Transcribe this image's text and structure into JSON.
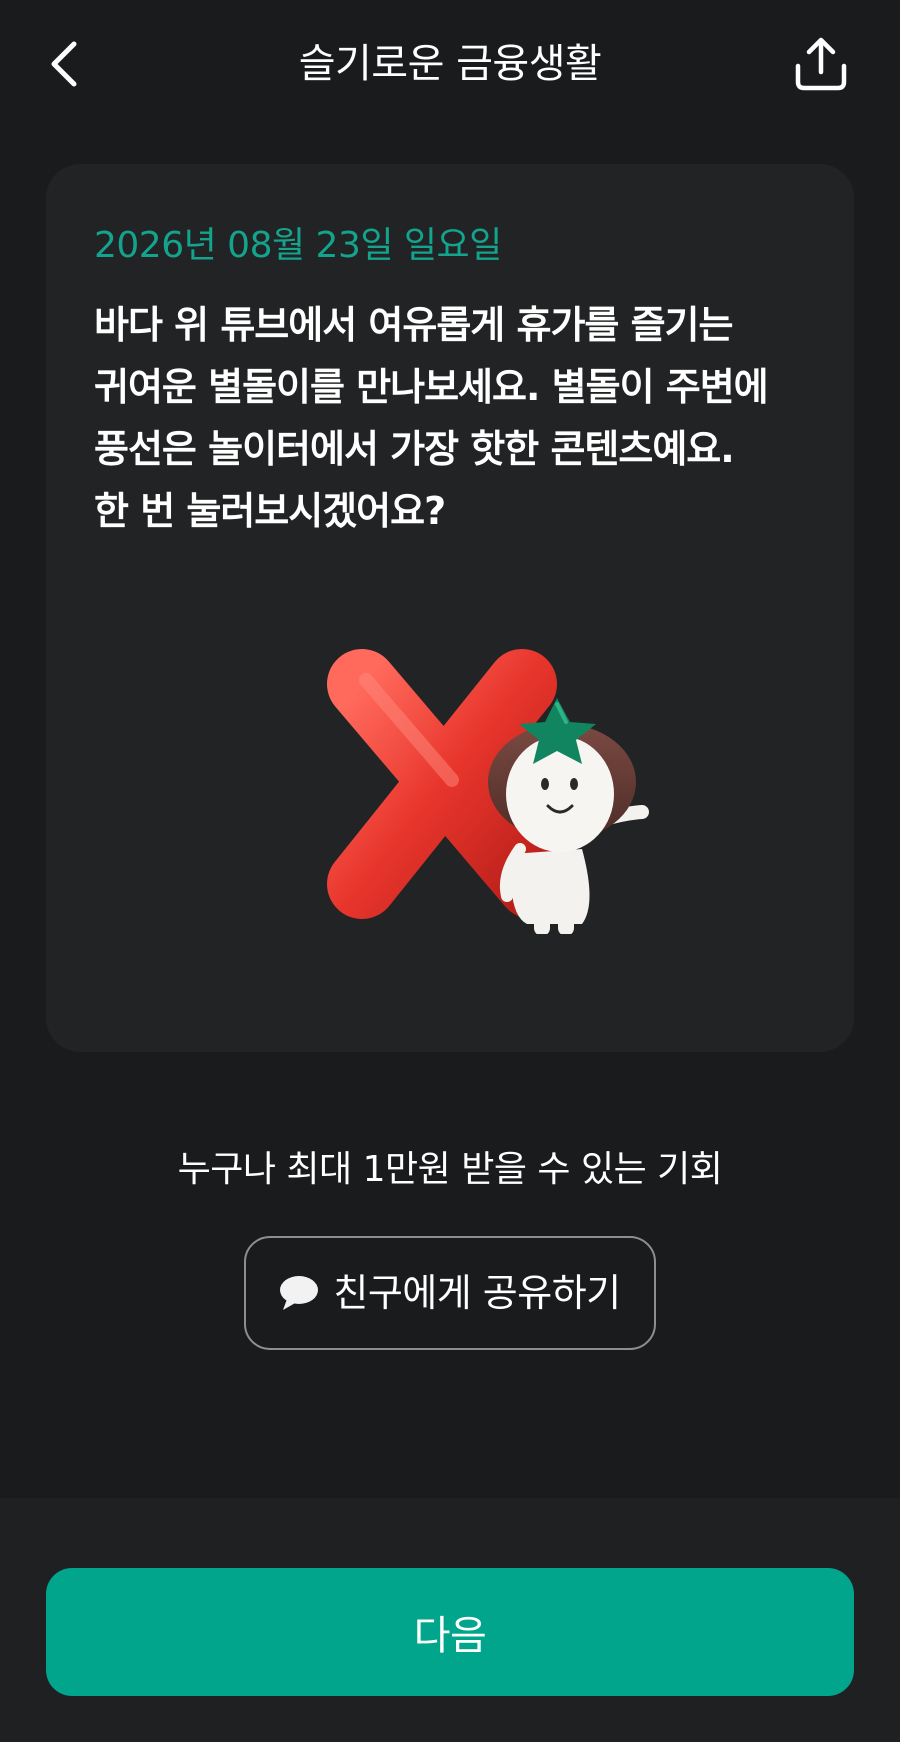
{
  "header": {
    "title": "슬기로운 금융생활",
    "back_icon": "chevron-left-icon",
    "share_icon": "share-upload-icon"
  },
  "card": {
    "date": "2026년 08월 23일 일요일",
    "body_lines": [
      "바다 위 튜브에서 여유롭게 휴가를 즐기는",
      "귀여운 별돌이를 만나보세요. 별돌이 주변에",
      "풍선은 놀이터에서 가장 핫한 콘텐츠예요.",
      "한 번 눌러보시겠어요?"
    ],
    "illustration": "red-x-mark-with-mascot"
  },
  "promo": {
    "text": "누구나 최대 1만원 받을 수 있는 기회",
    "share_button_label": "친구에게 공유하기",
    "share_button_icon": "speech-bubble-icon"
  },
  "footer": {
    "next_label": "다음"
  },
  "colors": {
    "background": "#1a1b1d",
    "card": "#222325",
    "accent": "#00a58c",
    "date_text": "#14a38c",
    "x_mark": "#e8352c",
    "star_hat": "#10855f"
  }
}
